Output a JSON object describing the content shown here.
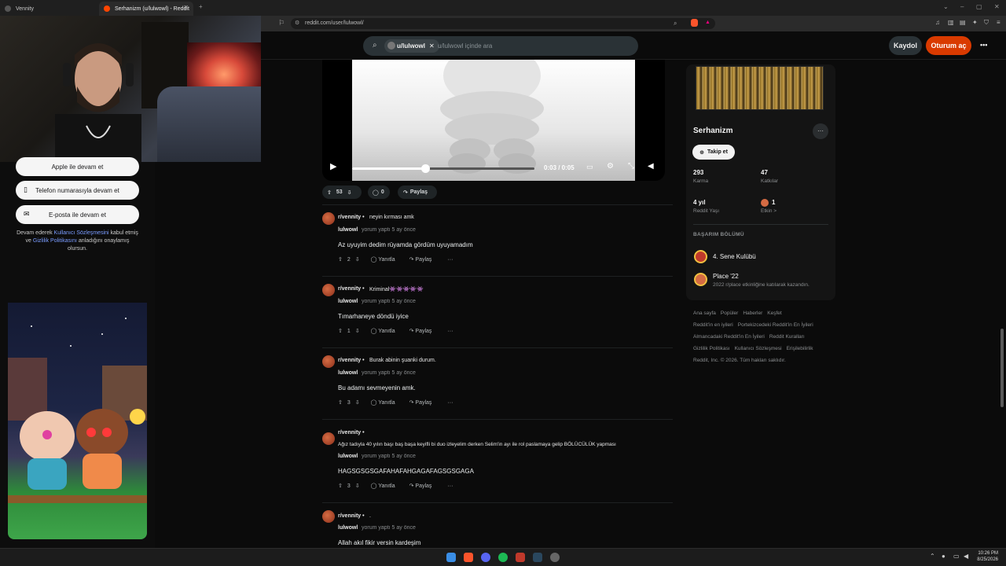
{
  "browser": {
    "tabs": [
      {
        "label": "Vennity"
      },
      {
        "label": "Serhanizm (u/lulwowl) - Reddit"
      }
    ],
    "url": "reddit.com/user/lulwowl/"
  },
  "header": {
    "search_chip": "u/lulwowl",
    "search_placeholder": "u/lulwowl içinde ara",
    "signup_label": "Kaydol",
    "login_label": "Oturum aç",
    "more_label": "•••"
  },
  "left_panel": {
    "apple_label": "Apple ile devam et",
    "phone_label": "Telefon numarasıyla devam et",
    "email_label": "E-posta ile devam et",
    "consent_prefix": "Devam ederek",
    "consent_link1": "Kullanıcı Sözleşmesini",
    "consent_mid1": "kabul etmiş ve",
    "consent_link2": "Gizlilik Politikasını",
    "consent_suffix": "anladığını onaylamış olursun."
  },
  "video": {
    "time": "0:03 / 0:05",
    "progress": 0.4
  },
  "post_actions": {
    "votes": "53",
    "comments": "0",
    "share": "Paylaş"
  },
  "comments": [
    {
      "subreddit": "r/vennity",
      "sep": "•",
      "post_title": "neyin kırması amk",
      "user": "lulwowl",
      "time": "yorum yaptı 5 ay önce",
      "body": "Az uyuyim dedim rüyamda gördüm uyuyamadım",
      "votes": "2",
      "reply": "Yanıtla",
      "share": "Paylaş",
      "more": "···"
    },
    {
      "subreddit": "r/vennity",
      "sep": "•",
      "post_title": "Kriminal👾👾👾👾👾",
      "user": "lulwowl",
      "time": "yorum yaptı 5 ay önce",
      "body": "Tımarhaneye döndü iyice",
      "votes": "1",
      "reply": "Yanıtla",
      "share": "Paylaş",
      "more": "···"
    },
    {
      "subreddit": "r/vennity",
      "sep": "•",
      "post_title": "Burak abinin şuanki durum.",
      "user": "lulwowl",
      "time": "yorum yaptı 5 ay önce",
      "body": "Bu adamı sevmeyenin amk.",
      "votes": "3",
      "reply": "Yanıtla",
      "share": "Paylaş",
      "more": "···"
    },
    {
      "subreddit": "r/vennity",
      "sep": "•",
      "post_title": "Ağız tadıyla 40 yılın başı baş başa keyifli bi duo izleyelim derken Selim'in ayı ile rol paslamaya gelip BÖLÜCÜLÜK yapması",
      "user": "lulwowl",
      "time": "yorum yaptı 5 ay önce",
      "body": "HAGSGSGSGAFAHAFAHGAGAFAGSGSGAGA",
      "votes": "3",
      "reply": "Yanıtla",
      "share": "Paylaş",
      "more": "···"
    },
    {
      "subreddit": "r/vennity",
      "sep": "•",
      "post_title": ".",
      "user": "lulwowl",
      "time": "yorum yaptı 5 ay önce",
      "body": "Allah akıl fikir versin kardeşim"
    }
  ],
  "profile": {
    "name": "Serhanizm",
    "follow_label": "Takip et",
    "karma_value": "293",
    "karma_label": "Karma",
    "contrib_value": "47",
    "contrib_label": "Katkılar",
    "age_value": "4 yıl",
    "age_label": "Reddit Yaşı",
    "active_value": "1",
    "active_label": "Etkin >",
    "achievements_title": "BAŞARIM BÖLÜMÜ",
    "ach1": "4. Sene Kulübü",
    "ach2_title": "Place '22",
    "ach2_desc": "2022 r/place etkinliğine katılarak kazandın."
  },
  "footer": {
    "links_row1": [
      "Ana sayfa",
      "Popüler",
      "Haberler",
      "Keşfet"
    ],
    "links_row2": [
      "Reddit'in en iyileri",
      "Portekizcedeki Reddit'in En İyileri"
    ],
    "links_row3": [
      "Almancadaki Reddit'in En İyileri",
      "Reddit Kuralları"
    ],
    "links_row4": [
      "Gizlilik Politikası",
      "Kullanıcı Sözleşmesi",
      "Erişilebilirlik"
    ],
    "copyright": "Reddit, Inc. © 2026. Tüm hakları saklıdır."
  },
  "taskbar": {
    "time": "10:26 PM",
    "date": "8/25/2026"
  }
}
